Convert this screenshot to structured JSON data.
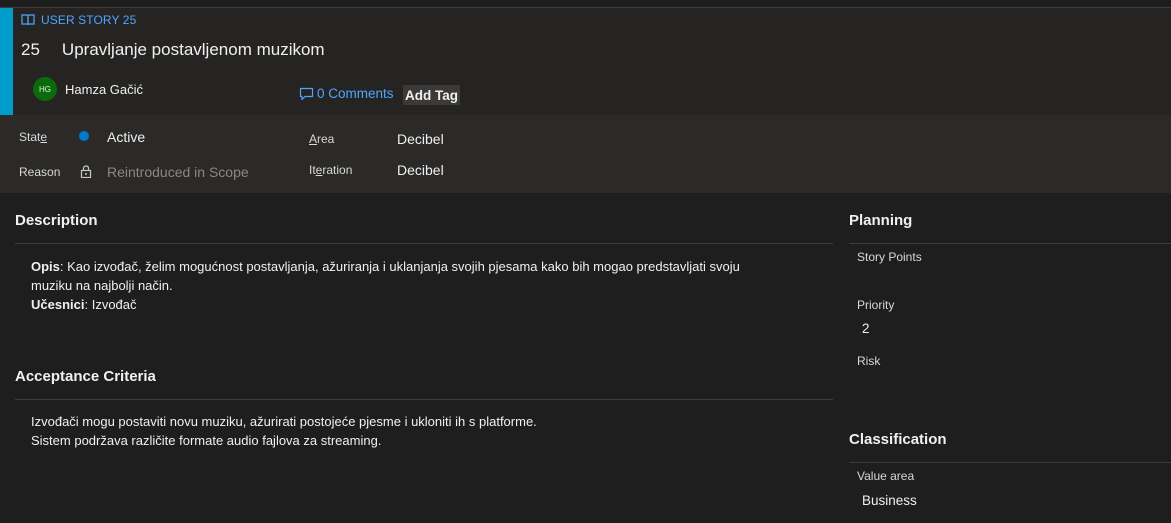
{
  "work_item": {
    "type_label": "USER STORY 25",
    "id": "25",
    "title": "Upravljanje postavljenom muzikom",
    "assignee": {
      "initials": "HG",
      "name": "Hamza Gačić"
    },
    "comments_label": "0 Comments",
    "add_tag_label": "Add Tag"
  },
  "fields": {
    "state": {
      "label_pre": "Stat",
      "label_key": "e",
      "value": "Active",
      "color": "#007acc"
    },
    "reason": {
      "label": "Reason",
      "value": "Reintroduced in Scope"
    },
    "area": {
      "label_key": "A",
      "label_post": "rea",
      "value": "Decibel"
    },
    "iteration": {
      "label_pre": "It",
      "label_key": "e",
      "label_post": "ration",
      "value": "Decibel"
    }
  },
  "description": {
    "title": "Description",
    "opis_label": "Opis",
    "opis_text": ": Kao izvođač, želim mogućnost postavljanja, ažuriranja i uklanjanja svojih pjesama kako bih mogao predstavljati svoju",
    "opis_text_cont": "muziku na najbolji način.",
    "ucesnici_label": "Učesnici",
    "ucesnici_text": ": Izvođač"
  },
  "acceptance": {
    "title": "Acceptance Criteria",
    "line1": "Izvođači mogu postaviti novu muziku, ažurirati postojeće pjesme i ukloniti ih s platforme.",
    "line2": "Sistem podržava različite formate audio fajlova za streaming."
  },
  "planning": {
    "title": "Planning",
    "story_points_label": "Story Points",
    "priority_label": "Priority",
    "priority_value": "2",
    "risk_label": "Risk"
  },
  "classification": {
    "title": "Classification",
    "value_area_label": "Value area",
    "value_area_value": "Business"
  },
  "colors": {
    "accent": "#009ccc",
    "link": "#4da6ff",
    "state_active": "#007acc",
    "avatar_bg": "#0b6a0b"
  },
  "icons": {
    "type": "book-icon",
    "comments": "comment-icon",
    "state": "state-dot-icon",
    "reason": "lock-icon"
  }
}
